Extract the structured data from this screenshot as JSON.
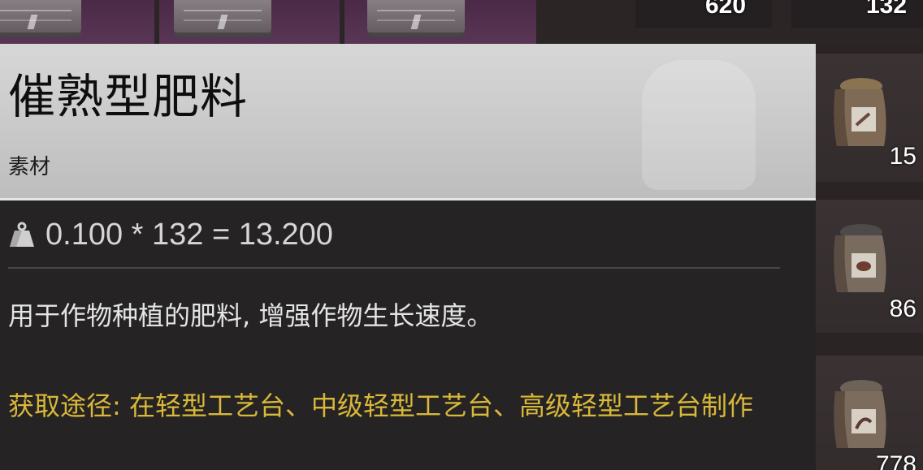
{
  "top_inventory": {
    "counts": [
      "620",
      "132"
    ]
  },
  "side_inventory": {
    "items": [
      {
        "icon": "fertilizer-sack-icon",
        "count": "15"
      },
      {
        "icon": "fertilizer-sack-icon",
        "count": "86"
      },
      {
        "icon": "fertilizer-sack-icon",
        "count": "778"
      }
    ]
  },
  "tooltip": {
    "title": "催熟型肥料",
    "category": "素材",
    "weight_icon": "weight-icon",
    "weight_formula": "0.100 * 132 = 13.200",
    "description": "用于作物种植的肥料, 增强作物生长速度。",
    "source": "获取途径: 在轻型工艺台、中级轻型工艺台、高级轻型工艺台制作"
  },
  "colors": {
    "header_bg": "#d7d7d7",
    "body_bg": "#252323",
    "source_text": "#d9b83a",
    "slot_purple": "#5a3656"
  }
}
